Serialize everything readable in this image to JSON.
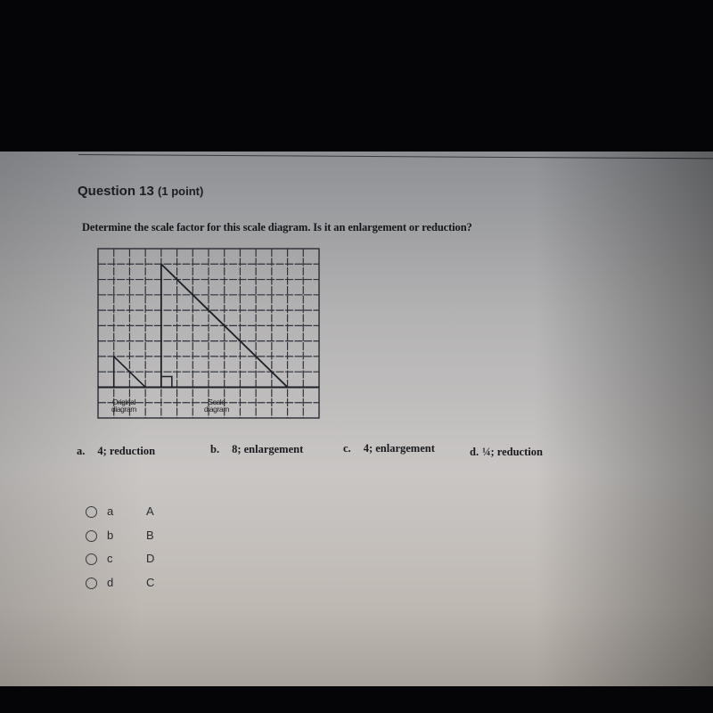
{
  "question": {
    "title": "Question 13",
    "points": "(1 point)",
    "prompt": "Determine the scale factor for this scale diagram. Is it an enlargement or reduction?"
  },
  "diagram": {
    "grid_columns": 14,
    "grid_rows": 11,
    "original_label_line1": "Original",
    "original_label_line2": "diagram",
    "scale_label_line1": "Scale",
    "scale_label_line2": "diagram",
    "original_triangle": {
      "height_units": 2,
      "base_units": 2
    },
    "scale_triangle": {
      "height_units": 8,
      "base_units": 8
    }
  },
  "choices": [
    {
      "letter": "a.",
      "text": "4; reduction"
    },
    {
      "letter": "b.",
      "text": "8; enlargement"
    },
    {
      "letter": "c.",
      "text": "4; enlargement"
    },
    {
      "letter": "d.",
      "text": "¼; reduction"
    }
  ],
  "options": [
    {
      "label": "a",
      "answer": "A",
      "selected": false
    },
    {
      "label": "b",
      "answer": "B",
      "selected": false
    },
    {
      "label": "c",
      "answer": "D",
      "selected": false
    },
    {
      "label": "d",
      "answer": "C",
      "selected": false
    }
  ]
}
